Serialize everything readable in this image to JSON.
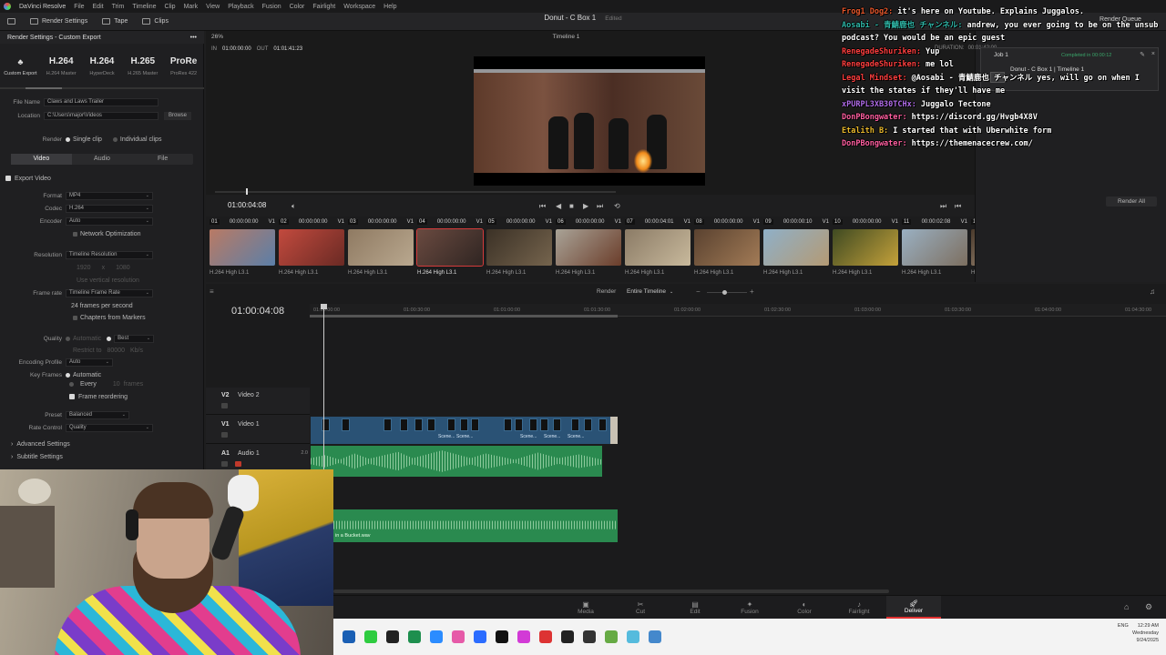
{
  "menubar": {
    "app": "DaVinci Resolve",
    "items": [
      "File",
      "Edit",
      "Trim",
      "Timeline",
      "Clip",
      "Mark",
      "View",
      "Playback",
      "Fusion",
      "Color",
      "Fairlight",
      "Workspace",
      "Help"
    ]
  },
  "toolbar": {
    "render_settings": "Render Settings",
    "tape": "Tape",
    "clips": "Clips"
  },
  "project": {
    "title": "Donut - C Box 1",
    "status": "Edited"
  },
  "render_settings": {
    "header": "Render Settings - Custom Export",
    "more": "•••",
    "presets": [
      {
        "big": "",
        "label": "Custom Export"
      },
      {
        "big": "H.264",
        "label": "H.264 Master"
      },
      {
        "big": "H.264",
        "label": "HyperDeck"
      },
      {
        "big": "H.265",
        "label": "H.265 Master"
      },
      {
        "big": "ProRe",
        "label": "ProRes 422"
      }
    ],
    "file_name_label": "File Name",
    "file_name": "Claws and Laws Trailer",
    "location_label": "Location",
    "location": "C:\\Users\\major\\Videos",
    "browse": "Browse",
    "render_label": "Render",
    "single_clip": "Single clip",
    "individual_clips": "Individual clips",
    "tabs": [
      "Video",
      "Audio",
      "File"
    ],
    "export_video": "Export Video",
    "format_label": "Format",
    "format": "MP4",
    "codec_label": "Codec",
    "codec": "H.264",
    "encoder_label": "Encoder",
    "encoder": "Auto",
    "network_opt": "Network Optimization",
    "resolution_label": "Resolution",
    "resolution": "Timeline Resolution",
    "res_w": "1920",
    "res_x": "x",
    "res_h": "1080",
    "vertical_res": "Use vertical resolution",
    "frame_rate_label": "Frame rate",
    "frame_rate": "Timeline Frame Rate",
    "fps_text": "24 frames per second",
    "chapters": "Chapters from Markers",
    "quality_label": "Quality",
    "quality_auto": "Automatic",
    "quality": "Best",
    "restrict_to": "Restrict to",
    "kbps_val": "80000",
    "kbps": "Kb/s",
    "encoding_profile_label": "Encoding Profile",
    "encoding_profile": "Auto",
    "key_frames_label": "Key Frames",
    "kf_auto": "Automatic",
    "kf_every": "Every",
    "kf_val": "10",
    "kf_frames": "frames",
    "frame_reordering": "Frame reordering",
    "preset_label": "Preset",
    "preset": "Balanced",
    "rate_control_label": "Rate Control",
    "rate_control": "Quality",
    "advanced": "Advanced Settings",
    "subtitle": "Subtitle Settings"
  },
  "viewer": {
    "zoom": "26%",
    "timeline_name": "Timeline 1",
    "in_label": "IN",
    "in_tc": "01:00:00:00",
    "out_label": "OUT",
    "out_tc": "01:01:41:23",
    "timecode": "01:00:04:08"
  },
  "clips": [
    {
      "n": "01",
      "tc": "00:00:00:00",
      "t": "V1",
      "codec": "H.264 High L3.1",
      "c1": "#b97a64",
      "c2": "#5b7fa8"
    },
    {
      "n": "02",
      "tc": "00:00:00:00",
      "t": "V1",
      "codec": "H.264 High L3.1",
      "c1": "#c24a3e",
      "c2": "#6a2a24"
    },
    {
      "n": "03",
      "tc": "00:00:00:00",
      "t": "V1",
      "codec": "H.264 High L3.1",
      "c1": "#8f7a62",
      "c2": "#b9a88f"
    },
    {
      "n": "04",
      "tc": "00:00:00:00",
      "t": "V1",
      "codec": "H.264 High L3.1",
      "c1": "#6a4a40",
      "c2": "#2f2522"
    },
    {
      "n": "05",
      "tc": "00:00:00:00",
      "t": "V1",
      "codec": "H.264 High L3.1",
      "c1": "#3b3126",
      "c2": "#75644d"
    },
    {
      "n": "06",
      "tc": "00:00:00:00",
      "t": "V1",
      "codec": "H.264 High L3.1",
      "c1": "#a9a397",
      "c2": "#6b3d2a"
    },
    {
      "n": "07",
      "tc": "00:00:04:01",
      "t": "V1",
      "codec": "H.264 High L3.1",
      "c1": "#8b7b66",
      "c2": "#c8b99c"
    },
    {
      "n": "08",
      "tc": "00:00:00:00",
      "t": "V1",
      "codec": "H.264 High L3.1",
      "c1": "#5a4230",
      "c2": "#a27b56"
    },
    {
      "n": "09",
      "tc": "00:00:00:10",
      "t": "V1",
      "codec": "H.264 High L3.1",
      "c1": "#8fb0c8",
      "c2": "#b49a74"
    },
    {
      "n": "10",
      "tc": "00:00:00:00",
      "t": "V1",
      "codec": "H.264 High L3.1",
      "c1": "#3f4a22",
      "c2": "#c4a13a"
    },
    {
      "n": "11",
      "tc": "00:00:02:08",
      "t": "V1",
      "codec": "H.264 High L3.1",
      "c1": "#9ab0c2",
      "c2": "#7d6f60"
    },
    {
      "n": "12",
      "tc": "00:00:00:00",
      "t": "V1",
      "codec": "H.264 High L3.1",
      "c1": "#4a3a2c",
      "c2": "#c9b39a"
    },
    {
      "n": "13",
      "tc": "00:00:00:00",
      "t": "V1",
      "codec": "H.264 High L3.1",
      "c1": "#2f8a5a",
      "c2": "#9be0b0"
    },
    {
      "n": "14",
      "tc": "00:00:00:00",
      "t": "V1",
      "codec": "H.264 High L3.1",
      "c1": "#7fb6e0",
      "c2": "#b58863"
    }
  ],
  "render_queue": {
    "title": "Render Queue",
    "job": "Job 1",
    "job_status": "Completed in 00:00:12",
    "job_name": "Donut - C Box 1 | Timeline 1",
    "duration_label": "DURATION:",
    "duration": "00:01:42:00",
    "render_all": "Render All"
  },
  "timeline": {
    "render_label": "Render",
    "render_mode": "Entire Timeline",
    "timecode": "01:00:04:08",
    "ruler": [
      "01:00:00:00",
      "01:00:30:00",
      "01:01:00:00",
      "01:01:30:00",
      "01:02:00:00",
      "01:02:30:00",
      "01:03:00:00",
      "01:03:30:00",
      "01:04:00:00",
      "01:04:30:00"
    ],
    "tracks": [
      {
        "id": "V2",
        "name": "Video 2"
      },
      {
        "id": "V1",
        "name": "Video 1"
      },
      {
        "id": "A1",
        "name": "Audio 1",
        "level": "2.0"
      }
    ],
    "scene_label": "Scene...",
    "wav_name": "in a Bucket.wav"
  },
  "pages": [
    "Media",
    "Cut",
    "Edit",
    "Fusion",
    "Color",
    "Fairlight",
    "Deliver"
  ],
  "active_page": "Deliver",
  "tray": {
    "lang": "ENG",
    "time": "12:29 AM",
    "day": "Wednesday",
    "date": "9/24/2025"
  },
  "chat": [
    {
      "user": "Frog1 Dog2:",
      "color": "#e8582c",
      "msg": "it's here on Youtube. Explains Juggalos."
    },
    {
      "user": "Aosabi - 青鯖鹿也 チャンネル:",
      "color": "#2fb7a8",
      "msg": "andrew, you ever going to be on the unsub podcast? You would be an epic guest"
    },
    {
      "user": "RenegadeShuriken:",
      "color": "#ff3f3f",
      "msg": "Yup"
    },
    {
      "user": "RenegadeShuriken:",
      "color": "#ff3f3f",
      "msg": "me lol"
    },
    {
      "user": "Legal Mindset:",
      "color": "#ff3f3f",
      "msg": "@Aosabi - 青鯖鹿也 チャンネル yes, will go on when I visit the states if they'll have me"
    },
    {
      "user": "xPURPL3XB30TCHx:",
      "color": "#b06ce8",
      "msg": "Juggalo Tectone"
    },
    {
      "user": "DonPBongwater:",
      "color": "#ff5fa0",
      "msg": "https://discord.gg/Hvgb4X8V"
    },
    {
      "user": "Etalith B:",
      "color": "#e8b82c",
      "msg": "I started that with Uberwhite form"
    },
    {
      "user": "DonPBongwater:",
      "color": "#ff5fa0",
      "msg": "https://themenacecrew.com/"
    }
  ],
  "colors": {
    "accent": "#e03030",
    "video_clip": "#2a5275",
    "audio_clip": "#2a8a4f"
  }
}
